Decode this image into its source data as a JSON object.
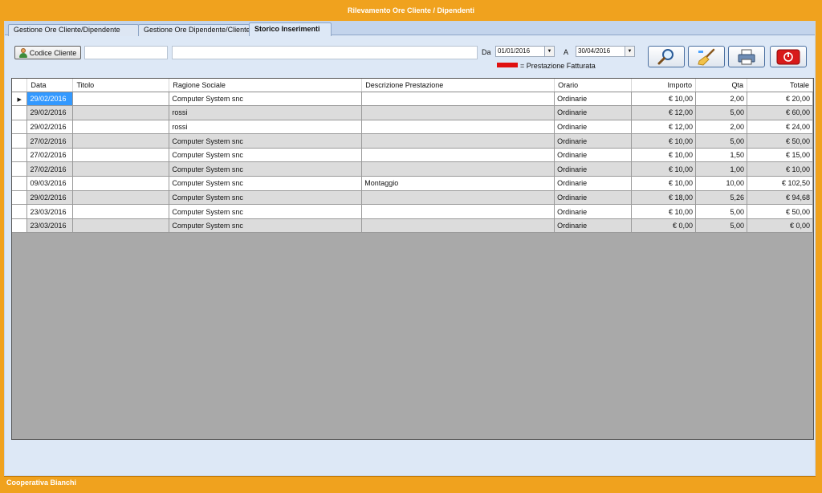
{
  "window": {
    "title": "Rilevamento Ore Cliente / Dipendenti"
  },
  "tabs": [
    {
      "label": "Gestione Ore Cliente/Dipendente"
    },
    {
      "label": "Gestione Ore Dipendente/Cliente"
    },
    {
      "label": "Storico Inserimenti"
    }
  ],
  "toolbar": {
    "codice_cliente_label": "Codice Cliente",
    "codice_value": "",
    "ragione_value": "",
    "da_label": "Da",
    "da_value": "01/01/2016",
    "a_label": "A",
    "a_value": "30/04/2016",
    "legend_text": "= Prestazione Fatturata",
    "legend_color": "#e01010"
  },
  "table": {
    "columns": [
      "Data",
      "Titolo",
      "Ragione Sociale",
      "Descrizione Prestazione",
      "Orario",
      "Importo",
      "Qta",
      "Totale"
    ],
    "rows": [
      [
        "29/02/2016",
        "",
        "Computer System snc",
        "",
        "Ordinarie",
        "€ 10,00",
        "2,00",
        "€ 20,00"
      ],
      [
        "29/02/2016",
        "",
        "rossi",
        "",
        "Ordinarie",
        "€ 12,00",
        "5,00",
        "€ 60,00"
      ],
      [
        "29/02/2016",
        "",
        "rossi",
        "",
        "Ordinarie",
        "€ 12,00",
        "2,00",
        "€ 24,00"
      ],
      [
        "27/02/2016",
        "",
        "Computer System snc",
        "",
        "Ordinarie",
        "€ 10,00",
        "5,00",
        "€ 50,00"
      ],
      [
        "27/02/2016",
        "",
        "Computer System snc",
        "",
        "Ordinarie",
        "€ 10,00",
        "1,50",
        "€ 15,00"
      ],
      [
        "27/02/2016",
        "",
        "Computer System snc",
        "",
        "Ordinarie",
        "€ 10,00",
        "1,00",
        "€ 10,00"
      ],
      [
        "09/03/2016",
        "",
        "Computer System snc",
        "Montaggio",
        "Ordinarie",
        "€ 10,00",
        "10,00",
        "€ 102,50"
      ],
      [
        "29/02/2016",
        "",
        "Computer System snc",
        "",
        "Ordinarie",
        "€ 18,00",
        "5,26",
        "€ 94,68"
      ],
      [
        "23/03/2016",
        "",
        "Computer System snc",
        "",
        "Ordinarie",
        "€ 10,00",
        "5,00",
        "€ 50,00"
      ],
      [
        "23/03/2016",
        "",
        "Computer System snc",
        "",
        "Ordinarie",
        "€ 0,00",
        "5,00",
        "€ 0,00"
      ]
    ]
  },
  "status": {
    "company": "Cooperativa Bianchi"
  },
  "icons": {
    "search": "magnifier-icon",
    "clear": "broom-icon",
    "print": "printer-icon",
    "exit": "power-icon"
  }
}
